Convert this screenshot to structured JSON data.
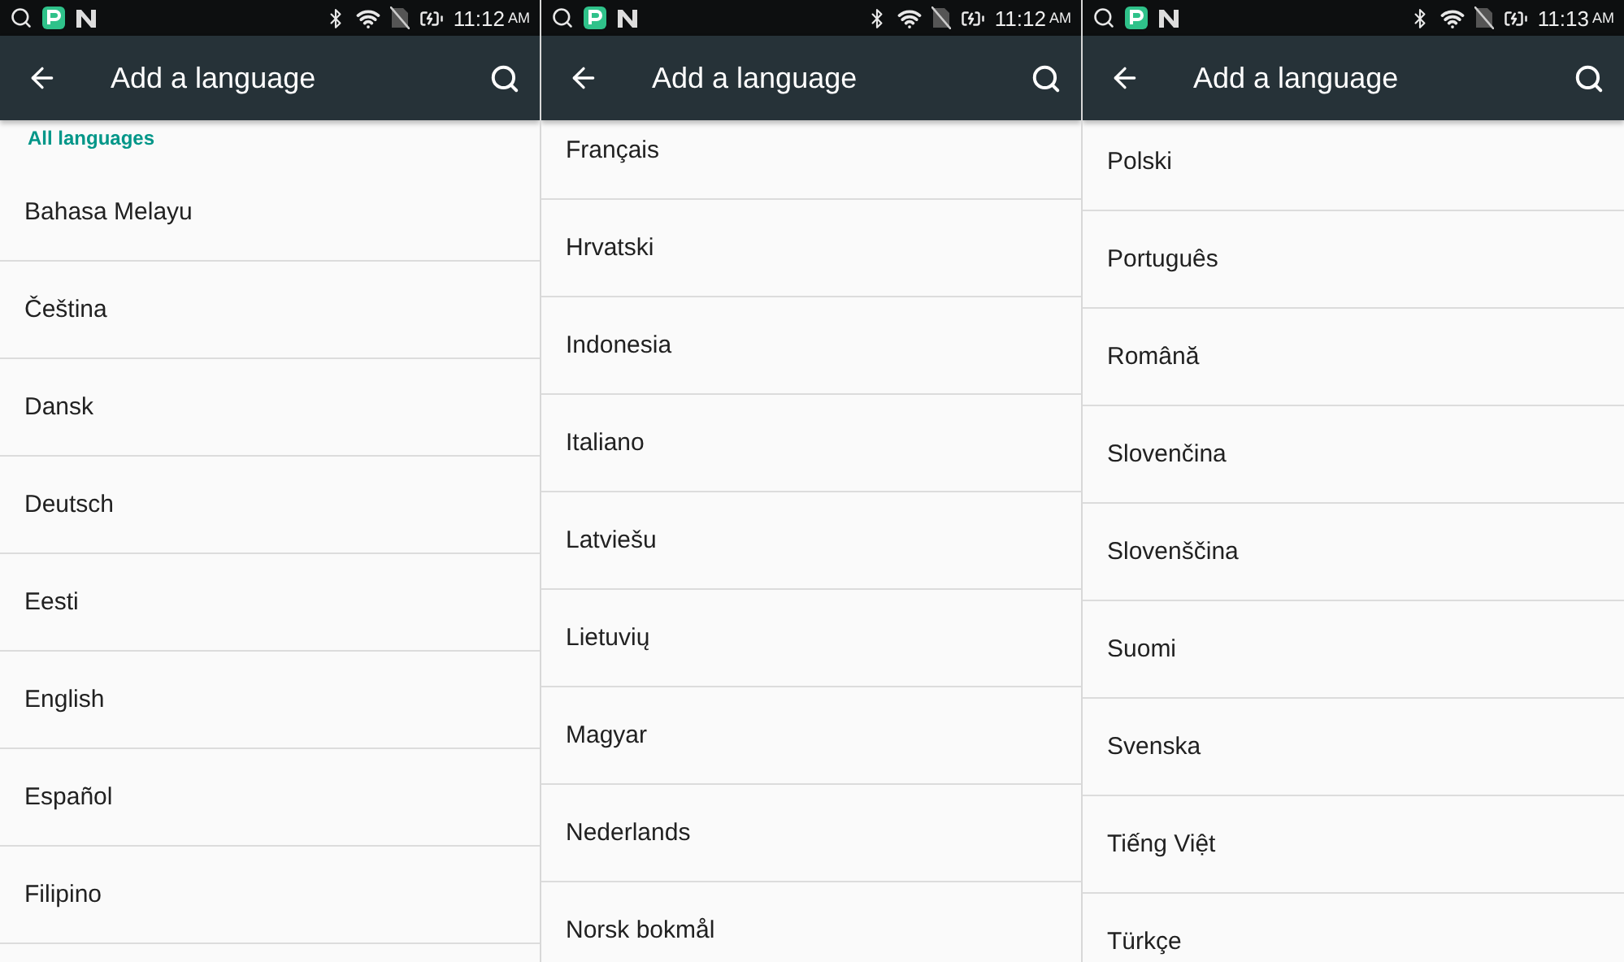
{
  "screens": [
    {
      "status_bar": {
        "time": "11:12",
        "meridiem": "AM"
      },
      "app_bar": {
        "title": "Add a language"
      },
      "section_header": "All languages",
      "items": [
        "Bahasa Melayu",
        "Čeština",
        "Dansk",
        "Deutsch",
        "Eesti",
        "English",
        "Español",
        "Filipino"
      ]
    },
    {
      "status_bar": {
        "time": "11:12",
        "meridiem": "AM"
      },
      "app_bar": {
        "title": "Add a language"
      },
      "items": [
        "Français",
        "Hrvatski",
        "Indonesia",
        "Italiano",
        "Latviešu",
        "Lietuvių",
        "Magyar",
        "Nederlands",
        "Norsk bokmål"
      ]
    },
    {
      "status_bar": {
        "time": "11:13",
        "meridiem": "AM"
      },
      "app_bar": {
        "title": "Add a language"
      },
      "items": [
        "Polski",
        "Português",
        "Română",
        "Slovenčina",
        "Slovenščina",
        "Suomi",
        "Svenska",
        "Tiếng Việt",
        "Türkçe"
      ]
    }
  ]
}
